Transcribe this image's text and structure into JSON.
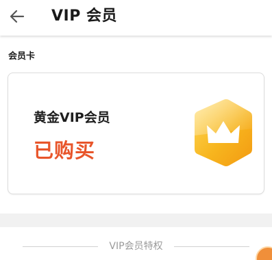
{
  "header": {
    "title": "VIP 会员",
    "back_icon": "arrow-left-icon"
  },
  "section": {
    "title": "会员卡"
  },
  "card": {
    "name": "黄金VIP会员",
    "status": "已购买",
    "badge_icon": "crown-icon",
    "status_color": "#e8552a",
    "badge_color": "#f7b51e"
  },
  "privileges": {
    "title": "VIP会员特权"
  },
  "floating_button": {
    "icon": "orange-circle-icon",
    "color": "#f08f3a"
  }
}
